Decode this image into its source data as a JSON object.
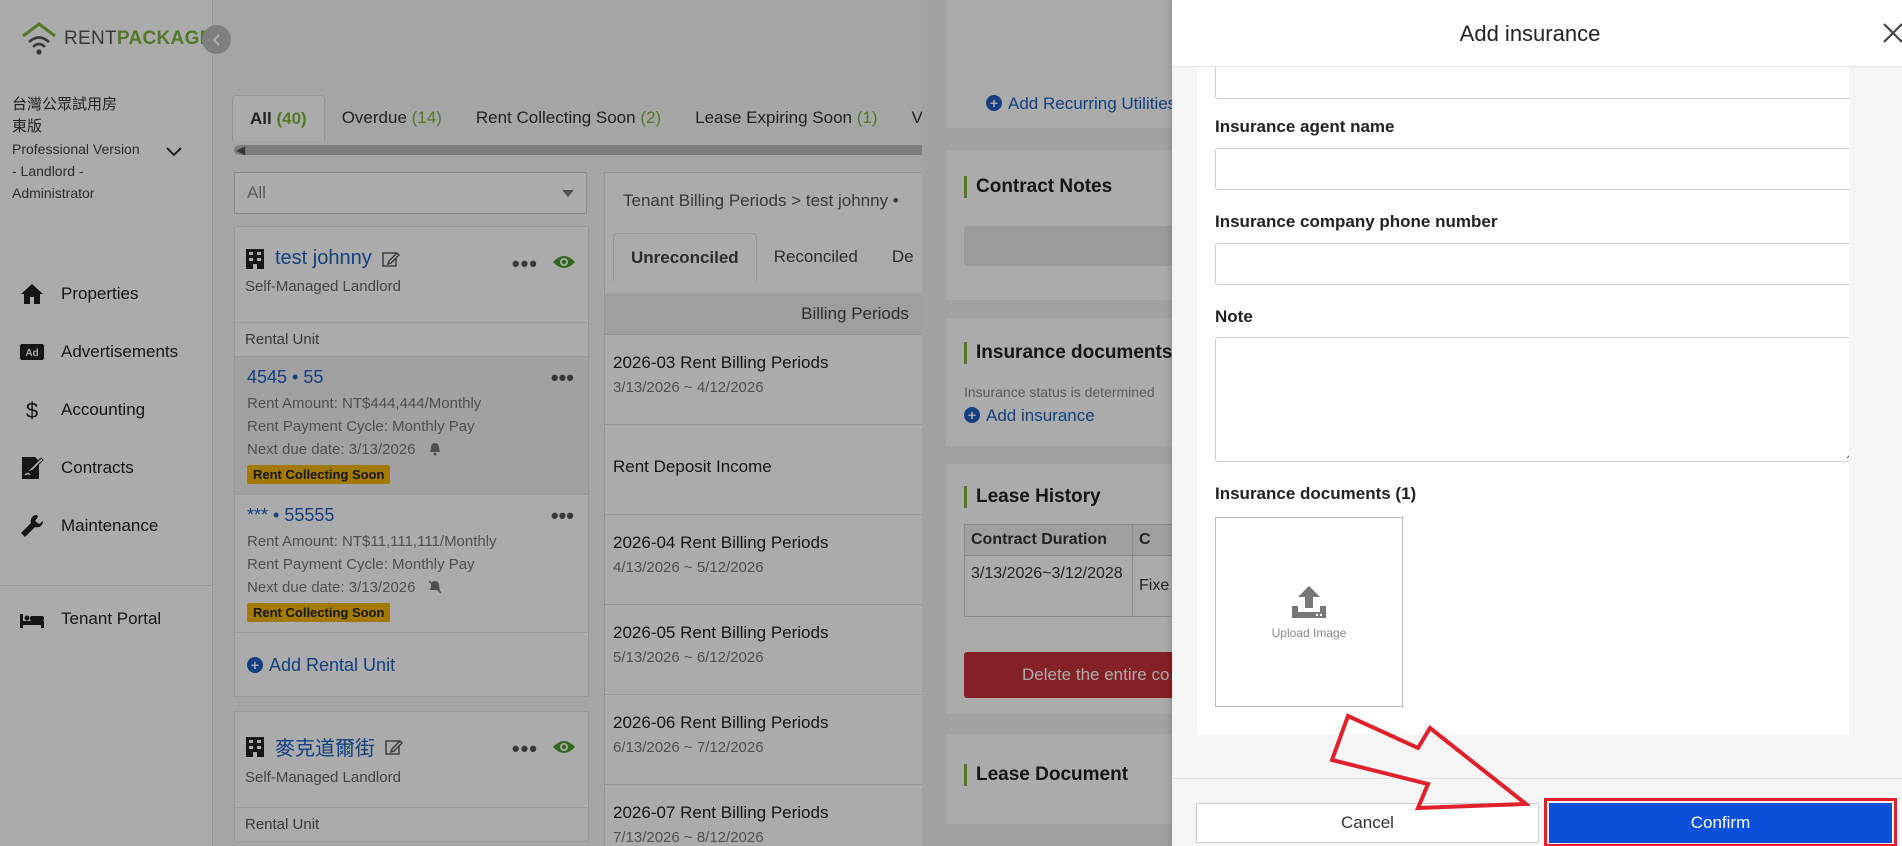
{
  "brand": {
    "rent": "RENT",
    "package": "PACKAGE",
    "accent": "#7bb33d"
  },
  "account": {
    "name_line1": "台灣公眾試用房",
    "name_line2": "東版",
    "role_lines": [
      "Professional Version",
      "- Landlord -",
      "Administrator"
    ]
  },
  "nav": {
    "items": [
      {
        "label": "Properties",
        "icon": "home-icon"
      },
      {
        "label": "Advertisements",
        "icon": "ad-icon"
      },
      {
        "label": "Accounting",
        "icon": "dollar-icon"
      },
      {
        "label": "Contracts",
        "icon": "contract-icon"
      },
      {
        "label": "Maintenance",
        "icon": "wrench-icon"
      }
    ],
    "tenant_portal": "Tenant Portal"
  },
  "tabs": [
    {
      "label": "All",
      "count": "(40)"
    },
    {
      "label": "Overdue",
      "count": "(14)"
    },
    {
      "label": "Rent Collecting Soon",
      "count": "(2)"
    },
    {
      "label": "Lease Expiring Soon",
      "count": "(1)"
    },
    {
      "label": "V",
      "count": ""
    }
  ],
  "filter": {
    "value": "All"
  },
  "properties": [
    {
      "name": "test johnny",
      "subtitle": "Self-Managed Landlord",
      "units_header": "Rental Unit",
      "units": [
        {
          "title_left": "4545",
          "title_right": "55",
          "rent": "Rent Amount: NT$444,444/Monthly",
          "cycle": "Rent Payment Cycle: Monthly Pay",
          "due": "Next due date:  3/13/2026",
          "badge": "Rent Collecting Soon"
        },
        {
          "title_left": "***",
          "title_right": "55555",
          "rent": "Rent Amount: NT$11,111,111/Monthly",
          "cycle": "Rent Payment Cycle: Monthly Pay",
          "due": "Next due date:  3/13/2026",
          "badge": "Rent Collecting Soon"
        }
      ],
      "add_unit": "Add Rental Unit"
    },
    {
      "name": "麥克道爾街",
      "subtitle": "Self-Managed Landlord",
      "units_header": "Rental Unit"
    }
  ],
  "billing": {
    "breadcrumb": "Tenant Billing Periods >  test johnny •",
    "tabs": [
      "Unreconciled",
      "Reconciled",
      "De"
    ],
    "header": "Billing Periods",
    "rows": [
      {
        "title": "2026-03 Rent Billing Periods",
        "range": "3/13/2026 ~ 4/12/2026"
      },
      {
        "title": "Rent Deposit Income",
        "range": ""
      },
      {
        "title": "2026-04 Rent Billing Periods",
        "range": "4/13/2026 ~ 5/12/2026"
      },
      {
        "title": "2026-05 Rent Billing Periods",
        "range": "5/13/2026 ~ 6/12/2026"
      },
      {
        "title": "2026-06 Rent Billing Periods",
        "range": "6/13/2026 ~ 7/12/2026"
      },
      {
        "title": "2026-07 Rent Billing Periods",
        "range": "7/13/2026 ~ 8/12/2026"
      }
    ]
  },
  "drawer": {
    "add_recurring": "Add Recurring Utilities F",
    "contract_notes": "Contract Notes",
    "insurance_docs": "Insurance documents",
    "insurance_note": "Insurance status is determined",
    "add_insurance": "Add insurance",
    "lease_history": "Lease History",
    "lease_cols": [
      "Contract Duration",
      "C"
    ],
    "lease_row": [
      "3/13/2026~3/12/2028",
      "Fixe"
    ],
    "delete_btn": "Delete the entire co",
    "lease_document": "Lease Document"
  },
  "modal": {
    "title": "Add insurance",
    "fields": {
      "agent_name": "Insurance agent name",
      "company_phone": "Insurance company phone number",
      "note": "Note",
      "documents": "Insurance documents (1)"
    },
    "upload_label": "Upload Image",
    "cancel": "Cancel",
    "confirm": "Confirm",
    "confirm_color": "#0b50d9",
    "highlight_color": "#e0202a"
  }
}
